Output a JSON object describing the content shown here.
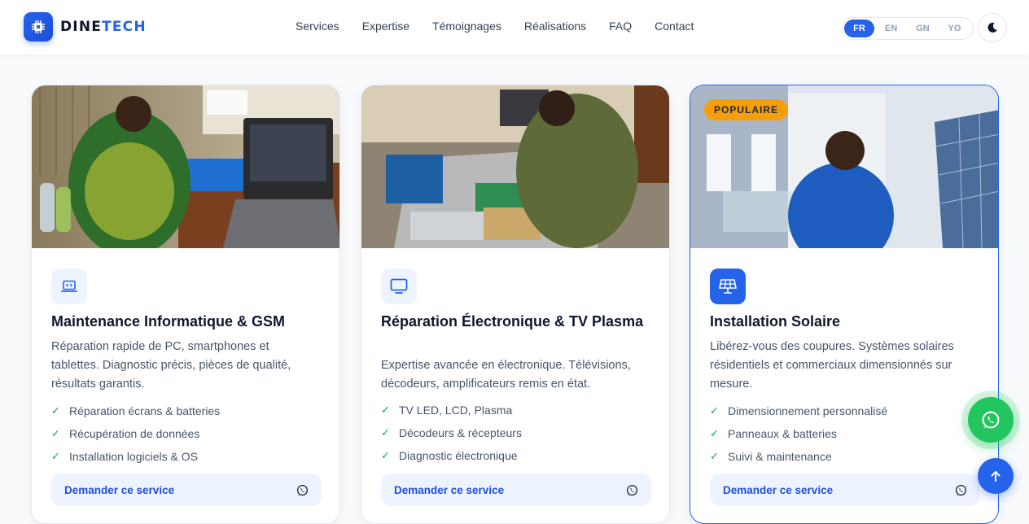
{
  "brand": {
    "name_part1": "DINE",
    "name_part2": "TECH",
    "logo_icon": "chip-icon"
  },
  "nav": {
    "items": [
      "Services",
      "Expertise",
      "Témoignages",
      "Réalisations",
      "FAQ",
      "Contact"
    ]
  },
  "languages": {
    "options": [
      "FR",
      "EN",
      "GN",
      "YO"
    ],
    "selected": "FR"
  },
  "theme_toggle": {
    "icon": "moon-icon"
  },
  "colors": {
    "accent": "#2563eb",
    "badge": "#f59e0b",
    "check": "#16a34a",
    "whatsapp": "#22c55e"
  },
  "cards": [
    {
      "icon": "laptop-code-icon",
      "title": "Maintenance Informatique & GSM",
      "description": "Réparation rapide de PC, smartphones et tablettes. Diagnostic précis, pièces de qualité, résultats garantis.",
      "features": [
        "Réparation écrans & batteries",
        "Récupération de données",
        "Installation logiciels & OS"
      ],
      "cta": "Demander ce service"
    },
    {
      "icon": "monitor-icon",
      "title": "Réparation Électronique & TV Plasma",
      "description": "Expertise avancée en électronique. Télévisions, décodeurs, amplificateurs remis en état.",
      "features": [
        "TV LED, LCD, Plasma",
        "Décodeurs & récepteurs",
        "Diagnostic électronique"
      ],
      "cta": "Demander ce service"
    },
    {
      "badge": "POPULAIRE",
      "icon": "solar-panel-icon",
      "title": "Installation Solaire",
      "description": "Libérez-vous des coupures. Systèmes solaires résidentiels et commerciaux dimensionnés sur mesure.",
      "features": [
        "Dimensionnement personnalisé",
        "Panneaux & batteries",
        "Suivi & maintenance"
      ],
      "cta": "Demander ce service"
    }
  ],
  "floating": {
    "whatsapp_icon": "whatsapp-icon",
    "back_to_top_icon": "arrow-up-icon"
  }
}
